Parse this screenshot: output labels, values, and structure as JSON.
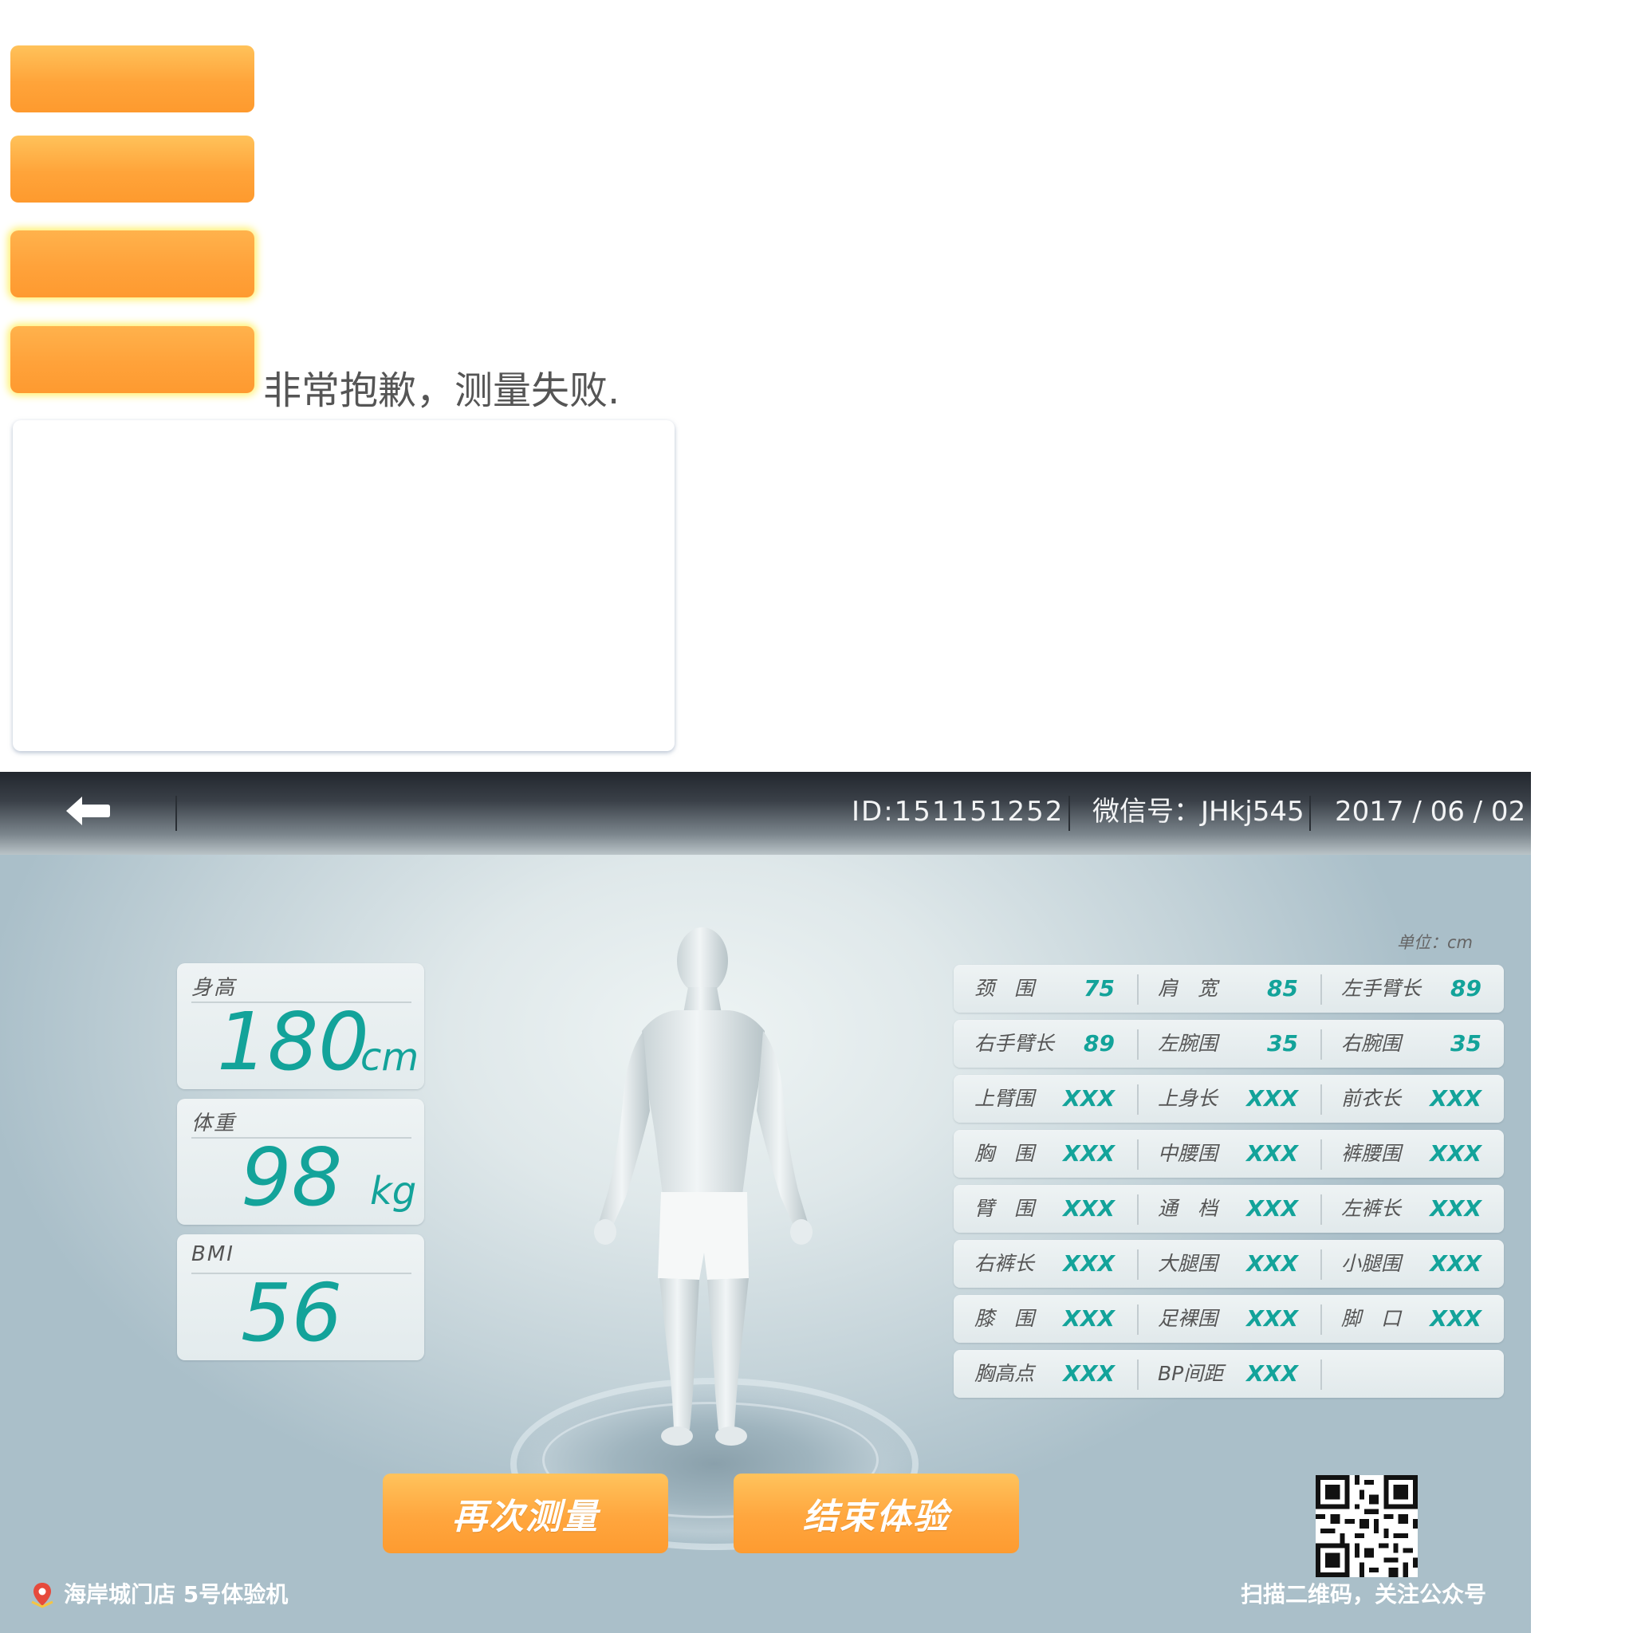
{
  "assets": {
    "failure_message": "非常抱歉，测量失败."
  },
  "header": {
    "id_text": "ID:151151252",
    "wechat_text": "微信号：JHkj545",
    "date_text": "2017 / 06 / 02"
  },
  "stats": {
    "height": {
      "label": "身高",
      "value": "180",
      "unit": "cm"
    },
    "weight": {
      "label": "体重",
      "value": "98",
      "unit": "kg"
    },
    "bmi": {
      "label": "BMI",
      "value": "56"
    }
  },
  "measurements": {
    "unit_note": "单位：cm",
    "rows": [
      [
        {
          "name": "颈　围",
          "value": "75"
        },
        {
          "name": "肩　宽",
          "value": "85"
        },
        {
          "name": "左手臂长",
          "value": "89"
        }
      ],
      [
        {
          "name": "右手臂长",
          "value": "89"
        },
        {
          "name": "左腕围",
          "value": "35"
        },
        {
          "name": "右腕围",
          "value": "35"
        }
      ],
      [
        {
          "name": "上臂围",
          "value": "XXX"
        },
        {
          "name": "上身长",
          "value": "XXX"
        },
        {
          "name": "前衣长",
          "value": "XXX"
        }
      ],
      [
        {
          "name": "胸　围",
          "value": "XXX"
        },
        {
          "name": "中腰围",
          "value": "XXX"
        },
        {
          "name": "裤腰围",
          "value": "XXX"
        }
      ],
      [
        {
          "name": "臂　围",
          "value": "XXX"
        },
        {
          "name": "通　档",
          "value": "XXX"
        },
        {
          "name": "左裤长",
          "value": "XXX"
        }
      ],
      [
        {
          "name": "右裤长",
          "value": "XXX"
        },
        {
          "name": "大腿围",
          "value": "XXX"
        },
        {
          "name": "小腿围",
          "value": "XXX"
        }
      ],
      [
        {
          "name": "膝　围",
          "value": "XXX"
        },
        {
          "name": "足裸围",
          "value": "XXX"
        },
        {
          "name": "脚　口",
          "value": "XXX"
        }
      ],
      [
        {
          "name": "胸高点",
          "value": "XXX"
        },
        {
          "name": "BP间距",
          "value": "XXX"
        },
        {
          "name": "",
          "value": ""
        }
      ]
    ]
  },
  "actions": {
    "remeasure_label": "再次测量",
    "finish_label": "结束体验"
  },
  "footer": {
    "store_text": "海岸城门店 5号体验机",
    "qr_caption": "扫描二维码，关注公众号"
  },
  "icons": {
    "back": "back-arrow-icon",
    "location": "location-pin-icon",
    "qr": "qr-code-icon"
  },
  "colors": {
    "accent_teal": "#13a39a",
    "button_orange": "#ffa63e",
    "header_dark": "#2a2f35"
  }
}
